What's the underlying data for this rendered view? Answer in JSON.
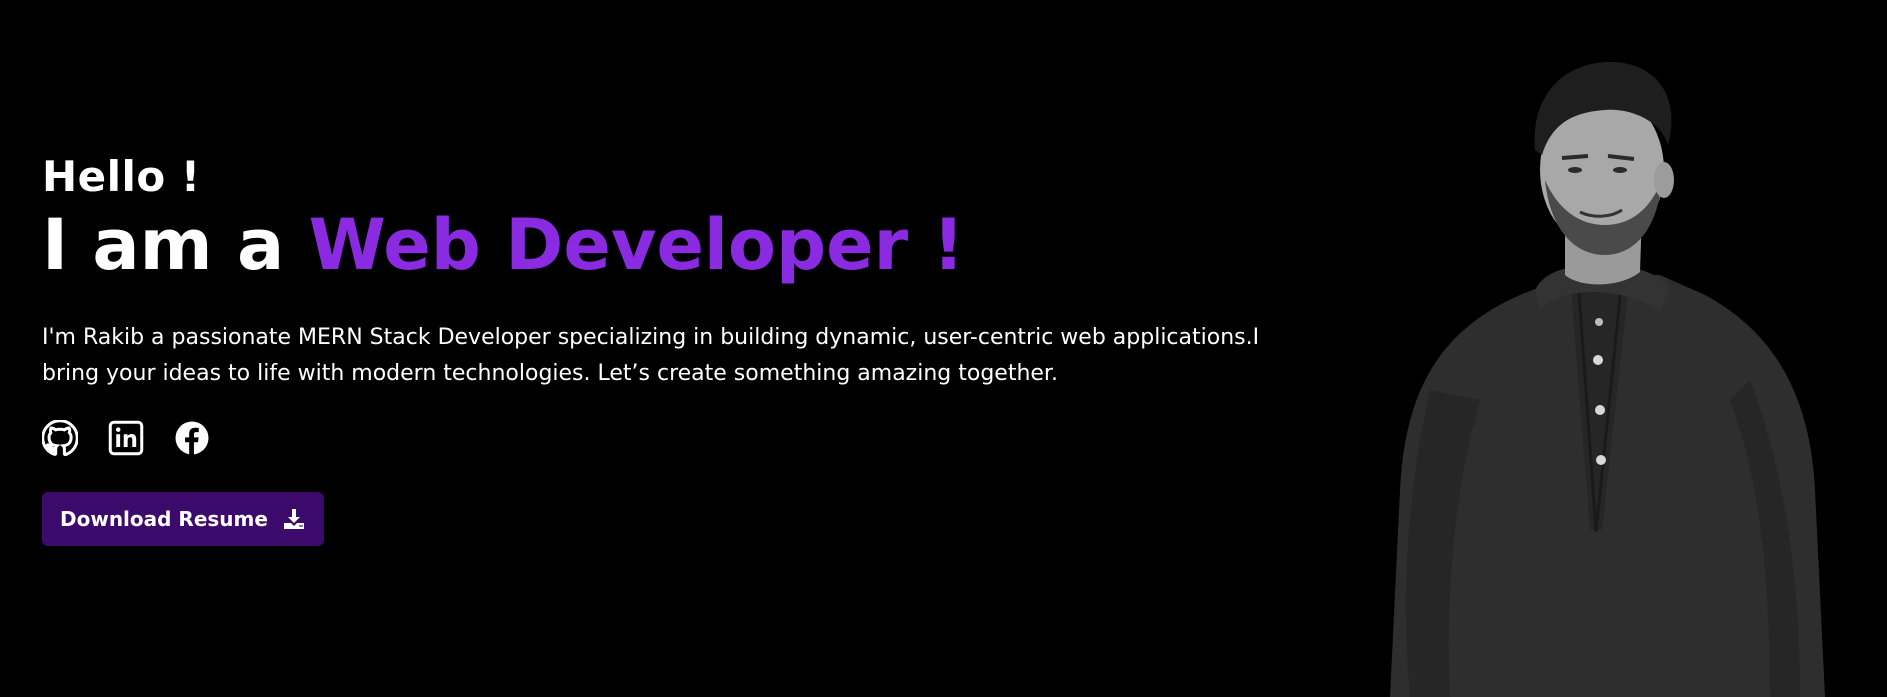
{
  "hero": {
    "greeting": "Hello !",
    "headline_prefix": "I am a ",
    "headline_accent": "Web Developer !",
    "description": "I'm Rakib a passionate MERN Stack Developer specializing in building dynamic, user-centric web applications.I bring your ideas to life with modern technologies. Let’s create something amazing together.",
    "resume_button_label": "Download Resume"
  },
  "socials": [
    {
      "icon": "github-icon"
    },
    {
      "icon": "linkedin-icon"
    },
    {
      "icon": "facebook-icon"
    }
  ],
  "colors": {
    "background": "#000000",
    "text": "#ffffff",
    "accent": "#8a2be2",
    "button": "#3b0a6b"
  }
}
